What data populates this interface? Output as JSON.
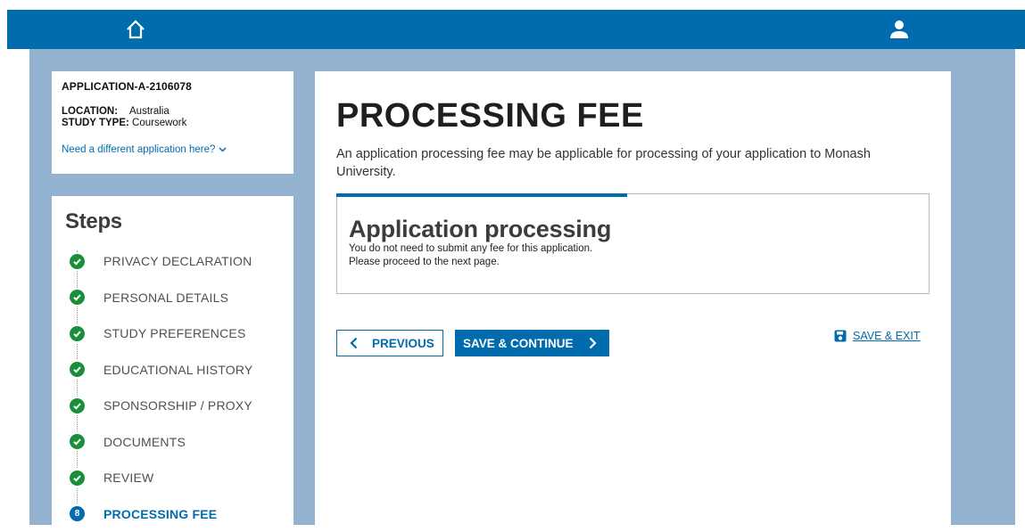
{
  "header": {
    "home_icon": "home-icon",
    "user_icon": "user-icon",
    "brand_color": "#006cae",
    "background_color": "#93b2d0"
  },
  "application": {
    "id": "APPLICATION-A-2106078",
    "location_label": "LOCATION:",
    "location_value": "Australia",
    "study_type_label": "STUDY TYPE:",
    "study_type_value": "Coursework",
    "switch_link": "Need a different application here?"
  },
  "steps": {
    "title": "Steps",
    "items": [
      {
        "label": "PRIVACY DECLARATION",
        "status": "complete"
      },
      {
        "label": "PERSONAL DETAILS",
        "status": "complete"
      },
      {
        "label": "STUDY PREFERENCES",
        "status": "complete"
      },
      {
        "label": "EDUCATIONAL HISTORY",
        "status": "complete"
      },
      {
        "label": "SPONSORSHIP / PROXY",
        "status": "complete"
      },
      {
        "label": "DOCUMENTS",
        "status": "complete"
      },
      {
        "label": "REVIEW",
        "status": "complete"
      },
      {
        "label": "PROCESSING FEE",
        "status": "current",
        "number": "8"
      }
    ],
    "complete_color": "#1a8f3a"
  },
  "main": {
    "title": "PROCESSING FEE",
    "intro": "An application processing fee may be applicable for processing of your application to Monash University.",
    "card": {
      "title": "Application processing",
      "line1": "You do not need to submit any fee for this application.",
      "line2": "Please proceed to the next page."
    },
    "actions": {
      "previous_label": "PREVIOUS",
      "save_continue_label": "SAVE & CONTINUE",
      "save_exit_label": "SAVE & EXIT"
    }
  }
}
